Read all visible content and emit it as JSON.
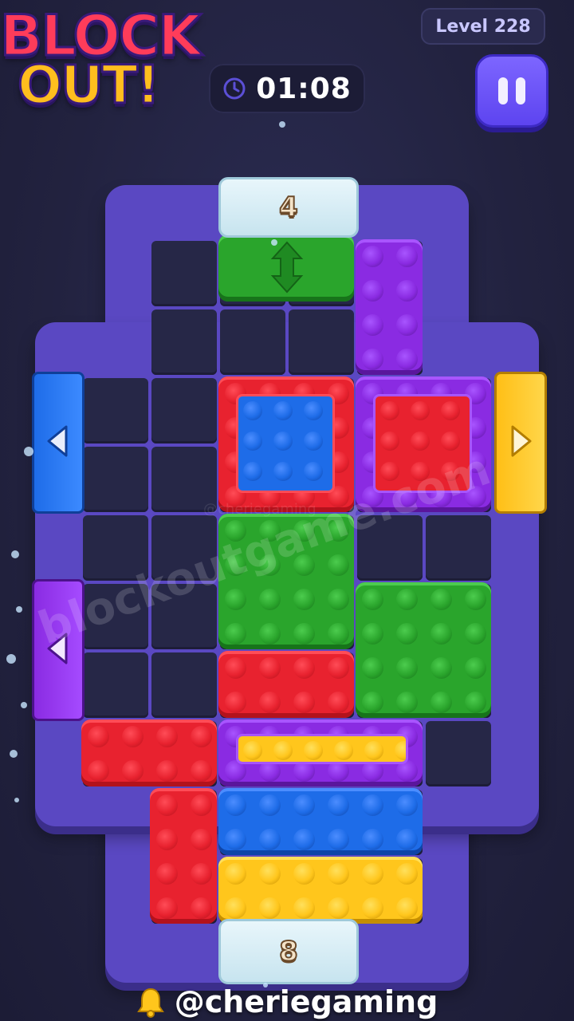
{
  "header": {
    "logo_line1": "BLOCK",
    "logo_line2": "OUT!",
    "level_label": "Level 228",
    "timer": "01:08"
  },
  "board": {
    "frame_color": "#5a48c2",
    "top_counter": "4",
    "bottom_counter": "8",
    "colors": {
      "red": "#e8222f",
      "blue": "#1e6ce8",
      "green": "#2aa52c",
      "purple": "#8a2be2",
      "yellow": "#ffc61c",
      "ice": "#d6eef6"
    },
    "gates": [
      {
        "side": "left",
        "color": "blue",
        "arrow": "left"
      },
      {
        "side": "left",
        "color": "purple",
        "arrow": "left"
      },
      {
        "side": "right",
        "color": "yellow",
        "arrow": "right"
      }
    ]
  },
  "watermarks": {
    "small": "@cheriegaming",
    "big": "blockoutgame.com"
  },
  "footer": {
    "handle": "@cheriegaming"
  }
}
